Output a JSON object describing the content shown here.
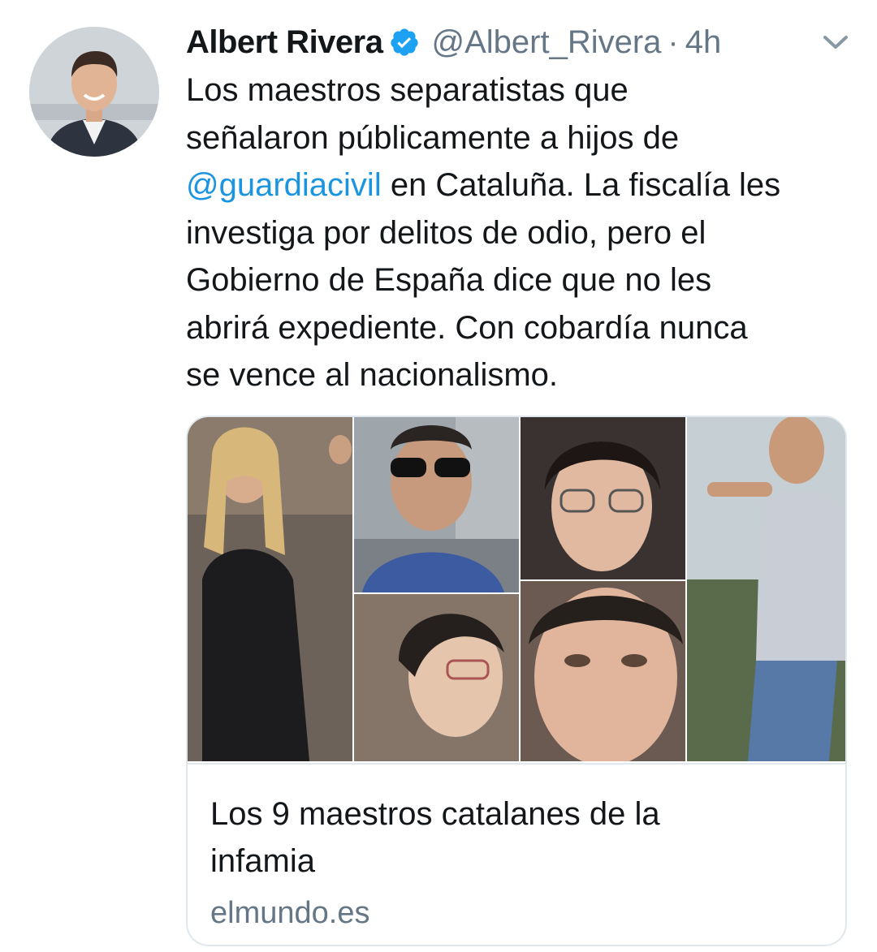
{
  "tweet": {
    "author": {
      "display_name": "Albert Rivera",
      "handle": "@Albert_Rivera",
      "verified": true,
      "avatar_icon": "profile-photo"
    },
    "separator": "·",
    "timestamp": "4h",
    "menu_icon": "chevron-down-icon",
    "text_lines": [
      "Los maestros separatistas que",
      "señalaron públicamente a hijos de",
      {
        "mention": "@guardiacivil",
        "rest": " en Cataluña. La fiscalía les"
      },
      "investiga por delitos de odio, pero el",
      "Gobierno de España dice que no les",
      "abrirá expediente. Con cobardía nunca",
      "se vence al nacionalismo."
    ],
    "mention_color": "#1b95e0",
    "card": {
      "title_lines": [
        "Los 9 maestros catalanes de la",
        "infamia"
      ],
      "domain": "elmundo.es",
      "image_description_icon": "photo-collage"
    }
  },
  "colors": {
    "text": "#14171a",
    "secondary": "#657786",
    "verified": "#1da1f2",
    "border": "#e1e8ed"
  }
}
